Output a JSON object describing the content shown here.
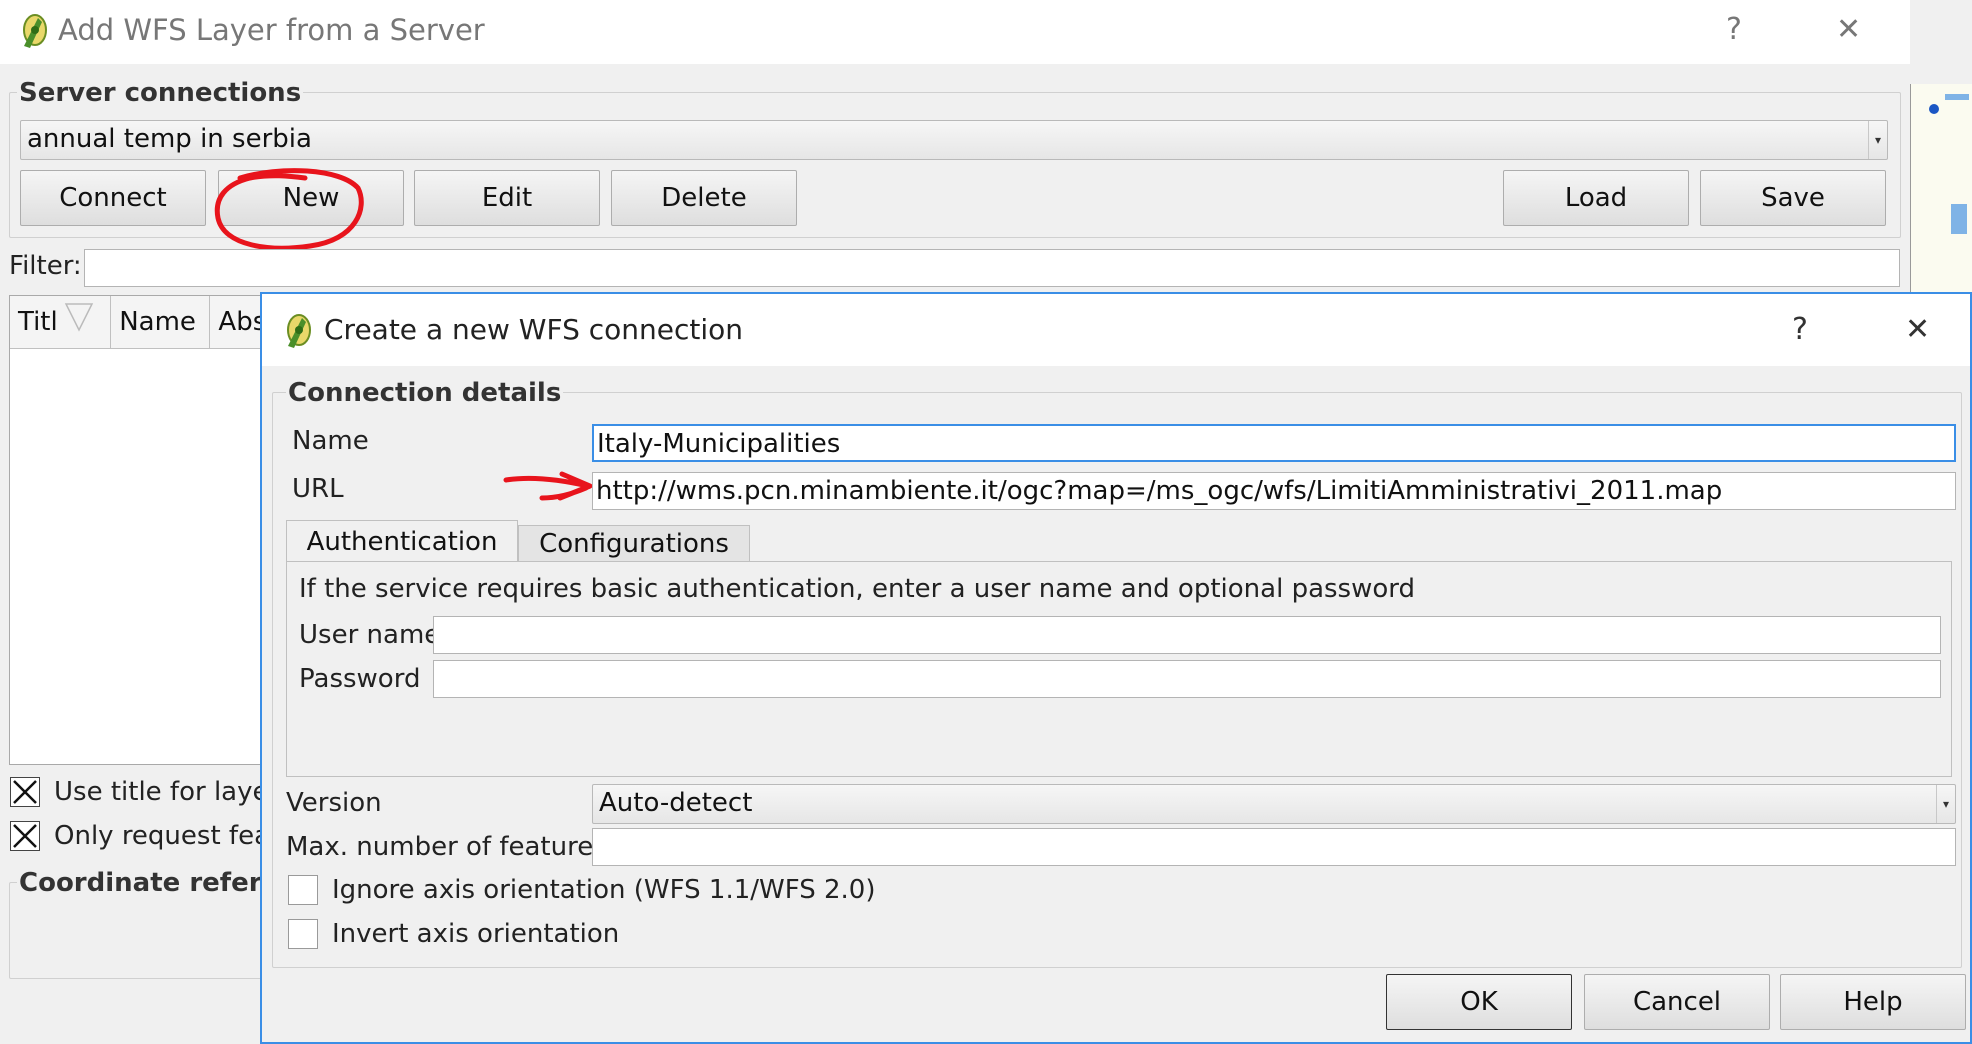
{
  "main_window": {
    "title": "Add WFS Layer from a Server",
    "help_glyph": "?",
    "close_glyph": "✕",
    "server_connections": {
      "title": "Server connections",
      "selected": "annual temp in serbia",
      "buttons": {
        "connect": "Connect",
        "new": "New",
        "edit": "Edit",
        "delete": "Delete",
        "load": "Load",
        "save": "Save"
      }
    },
    "filter_label": "Filter:",
    "filter_value": "",
    "table_headers": [
      "Titl",
      "Name",
      "Abs"
    ],
    "checkboxes": [
      {
        "label": "Use title for layer",
        "checked": true
      },
      {
        "label": "Only request feat",
        "checked": true
      }
    ],
    "crs_title": "Coordinate refere"
  },
  "dialog": {
    "title": "Create a new WFS connection",
    "help_glyph": "?",
    "close_glyph": "✕",
    "group_title": "Connection details",
    "name_label": "Name",
    "name_value": "Italy-Municipalities",
    "url_label": "URL",
    "url_value": "http://wms.pcn.minambiente.it/ogc?map=/ms_ogc/wfs/LimitiAmministrativi_2011.map",
    "tabs": [
      "Authentication",
      "Configurations"
    ],
    "auth_info": "If the service requires basic authentication, enter a user name and optional password",
    "username_label": "User name",
    "username_value": "",
    "password_label": "Password",
    "password_value": "",
    "version_label": "Version",
    "version_value": "Auto-detect",
    "max_features_label": "Max. number of features",
    "max_features_value": "",
    "checkboxes": [
      {
        "label": "Ignore axis orientation (WFS 1.1/WFS 2.0)",
        "checked": false
      },
      {
        "label": "Invert axis orientation",
        "checked": false
      }
    ],
    "buttons": {
      "ok": "OK",
      "cancel": "Cancel",
      "help": "Help"
    }
  },
  "colors": {
    "annotation_red": "#e8141c",
    "focus_blue": "#3a8ee6"
  },
  "icons": [
    "qgis-logo-icon",
    "help-icon",
    "close-icon",
    "combo-arrow-icon",
    "sort-arrow-icon",
    "check-x-icon"
  ]
}
